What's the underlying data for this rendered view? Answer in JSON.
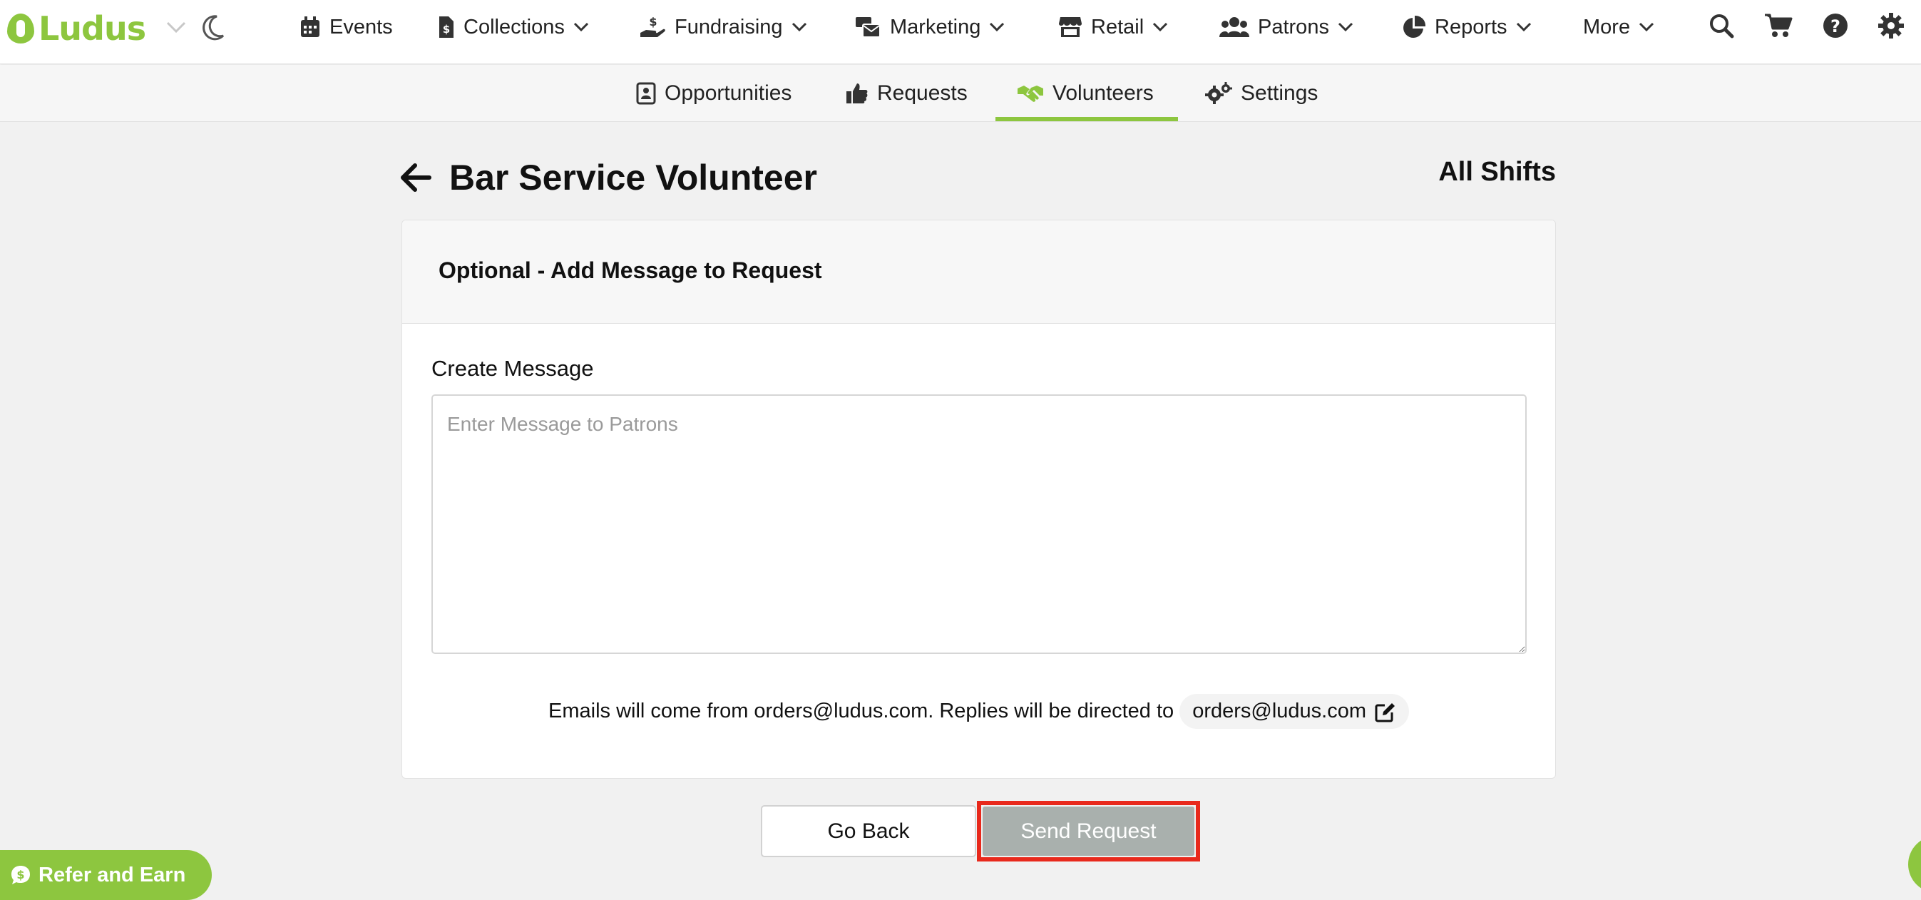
{
  "app": {
    "logo_text": "Ludus",
    "brand_color": "#8dc63f",
    "highlight_color": "#e8291c"
  },
  "topnav": {
    "items": [
      {
        "label": "Events",
        "icon": "calendar-icon"
      },
      {
        "label": "Collections",
        "icon": "file-dollar-icon"
      },
      {
        "label": "Fundraising",
        "icon": "hand-holding-dollar-icon"
      },
      {
        "label": "Marketing",
        "icon": "mail-bulk-icon"
      },
      {
        "label": "Retail",
        "icon": "store-icon"
      },
      {
        "label": "Patrons",
        "icon": "users-icon"
      },
      {
        "label": "Reports",
        "icon": "chart-pie-icon"
      },
      {
        "label": "More",
        "icon": "chevron-down-icon"
      }
    ],
    "tools": [
      "search-icon",
      "cart-icon",
      "help-icon",
      "gear-icon"
    ]
  },
  "subnav": {
    "items": [
      {
        "label": "Opportunities",
        "icon": "contact-card-icon"
      },
      {
        "label": "Requests",
        "icon": "thumbs-up-icon"
      },
      {
        "label": "Volunteers",
        "icon": "handshake-icon",
        "active": true
      },
      {
        "label": "Settings",
        "icon": "gears-icon"
      }
    ]
  },
  "page": {
    "title": "Bar Service Volunteer",
    "right_link": "All Shifts"
  },
  "card": {
    "title": "Optional - Add Message to Request",
    "field_label": "Create Message",
    "message_placeholder": "Enter Message to Patrons",
    "message_value": "",
    "email_note": "Emails will come from orders@ludus.com. Replies will be directed to",
    "reply_email": "orders@ludus.com"
  },
  "actions": {
    "back_label": "Go Back",
    "send_label": "Send Request"
  },
  "floating": {
    "refer_label": "Refer and Earn"
  }
}
